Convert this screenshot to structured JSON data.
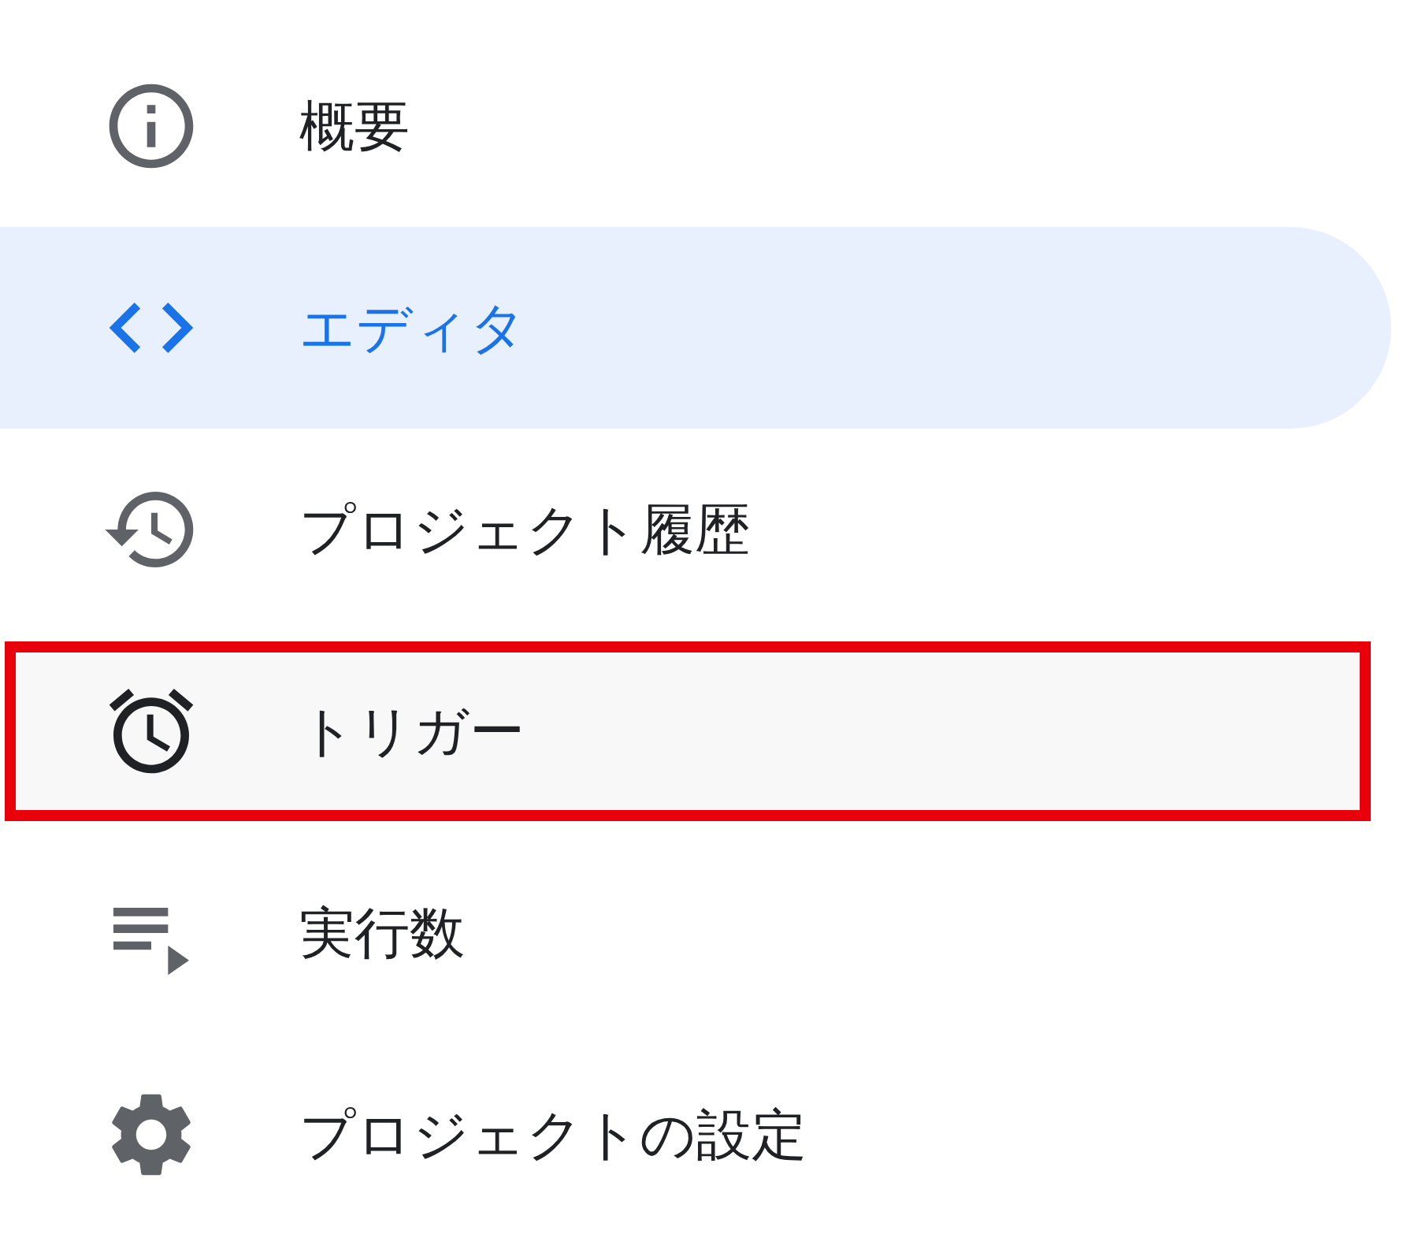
{
  "nav": {
    "items": [
      {
        "label": "概要",
        "kind": "info",
        "selected": false,
        "highlighted": false
      },
      {
        "label": "エディタ",
        "kind": "code",
        "selected": true,
        "highlighted": false
      },
      {
        "label": "プロジェクト履歴",
        "kind": "history",
        "selected": false,
        "highlighted": false
      },
      {
        "label": "トリガー",
        "kind": "alarm",
        "selected": false,
        "highlighted": true
      },
      {
        "label": "実行数",
        "kind": "executions",
        "selected": false,
        "highlighted": false
      },
      {
        "label": "プロジェクトの設定",
        "kind": "settings",
        "selected": false,
        "highlighted": false
      }
    ]
  }
}
